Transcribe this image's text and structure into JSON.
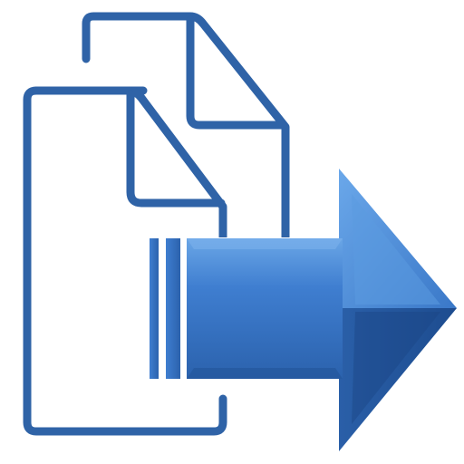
{
  "icon": {
    "name": "export-documents-icon",
    "colors": {
      "outline": "#2f63a7",
      "arrow_light": "#5b9be0",
      "arrow_mid": "#3c7bcd",
      "arrow_dark": "#1f4f93",
      "background": "#ffffff"
    },
    "parts": [
      "back-document-icon",
      "front-document-icon",
      "right-arrow-icon"
    ]
  }
}
